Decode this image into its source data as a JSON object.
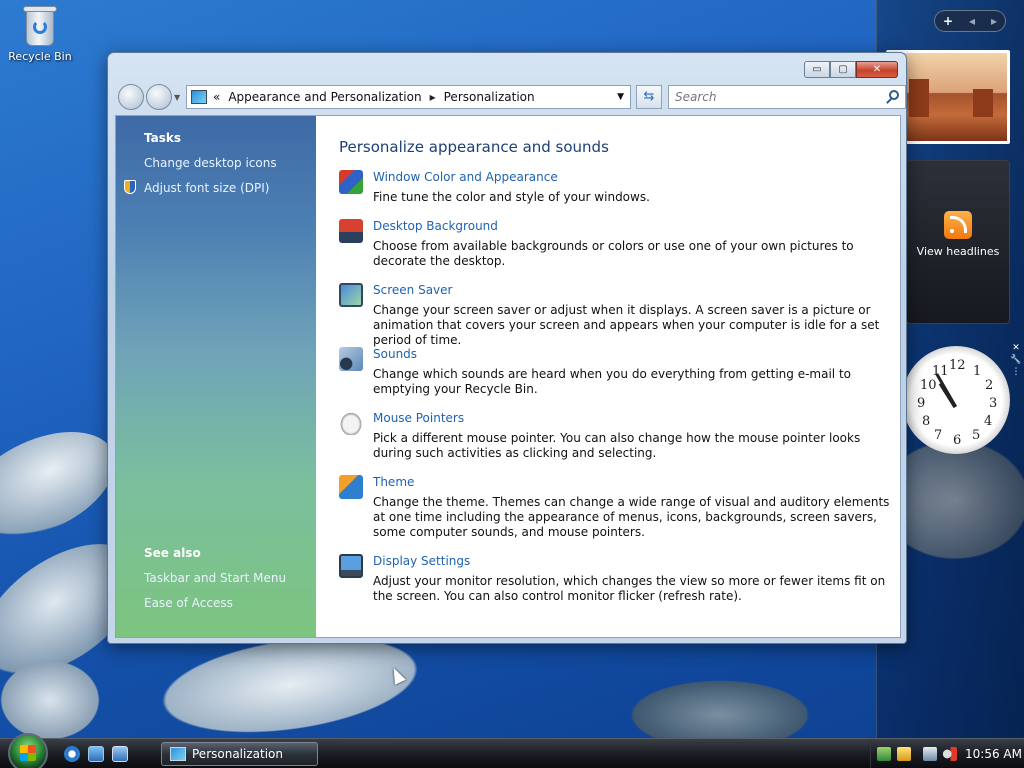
{
  "desktop": {
    "recycle_bin_label": "Recycle Bin"
  },
  "window": {
    "breadcrumb": {
      "overflow": "«",
      "parent": "Appearance and Personalization",
      "separator": "▸",
      "current": "Personalization"
    },
    "search_placeholder": "Search",
    "buttons": {
      "minimize": "▭",
      "maximize": "▢",
      "close": "✕"
    }
  },
  "left_pane": {
    "tasks_heading": "Tasks",
    "tasks": [
      "Change desktop icons",
      "Adjust font size (DPI)"
    ],
    "see_also_heading": "See also",
    "see_also": [
      "Taskbar and Start Menu",
      "Ease of Access"
    ]
  },
  "content": {
    "title": "Personalize appearance and sounds",
    "items": [
      {
        "label": "Window Color and Appearance",
        "desc": "Fine tune the color and style of your windows.",
        "icon": "colors-icon"
      },
      {
        "label": "Desktop Background",
        "desc": "Choose from available backgrounds or colors or use one of your own pictures to decorate the desktop.",
        "icon": "desktop-background-icon"
      },
      {
        "label": "Screen Saver",
        "desc": "Change your screen saver or adjust when it displays. A screen saver is a picture or animation that covers your screen and appears when your computer is idle for a set period of time.",
        "icon": "screen-saver-icon"
      },
      {
        "label": "Sounds",
        "desc": "Change which sounds are heard when you do everything from getting e-mail to emptying your Recycle Bin.",
        "icon": "sounds-icon"
      },
      {
        "label": "Mouse Pointers",
        "desc": "Pick a different mouse pointer. You can also change how the mouse pointer looks during such activities as clicking and selecting.",
        "icon": "mouse-pointer-icon"
      },
      {
        "label": "Theme",
        "desc": "Change the theme. Themes can change a wide range of visual and auditory elements at one time including the appearance of menus, icons, backgrounds, screen savers, some computer sounds, and mouse pointers.",
        "icon": "theme-icon"
      },
      {
        "label": "Display Settings",
        "desc": "Adjust your monitor resolution, which changes the view so more or fewer items fit on the screen. You can also control monitor flicker (refresh rate).",
        "icon": "display-settings-icon"
      }
    ]
  },
  "sidebar": {
    "controls": {
      "add": "+",
      "prev": "◂",
      "next": "▸"
    },
    "feed_label": "View headlines",
    "clock_numbers": [
      "12",
      "1",
      "2",
      "3",
      "4",
      "5",
      "6",
      "7",
      "8",
      "9",
      "10",
      "11"
    ],
    "gadget_tool_glyphs": [
      "✕",
      "🔧",
      "⋮"
    ]
  },
  "taskbar": {
    "task_label": "Personalization",
    "time": "10:56 AM"
  }
}
